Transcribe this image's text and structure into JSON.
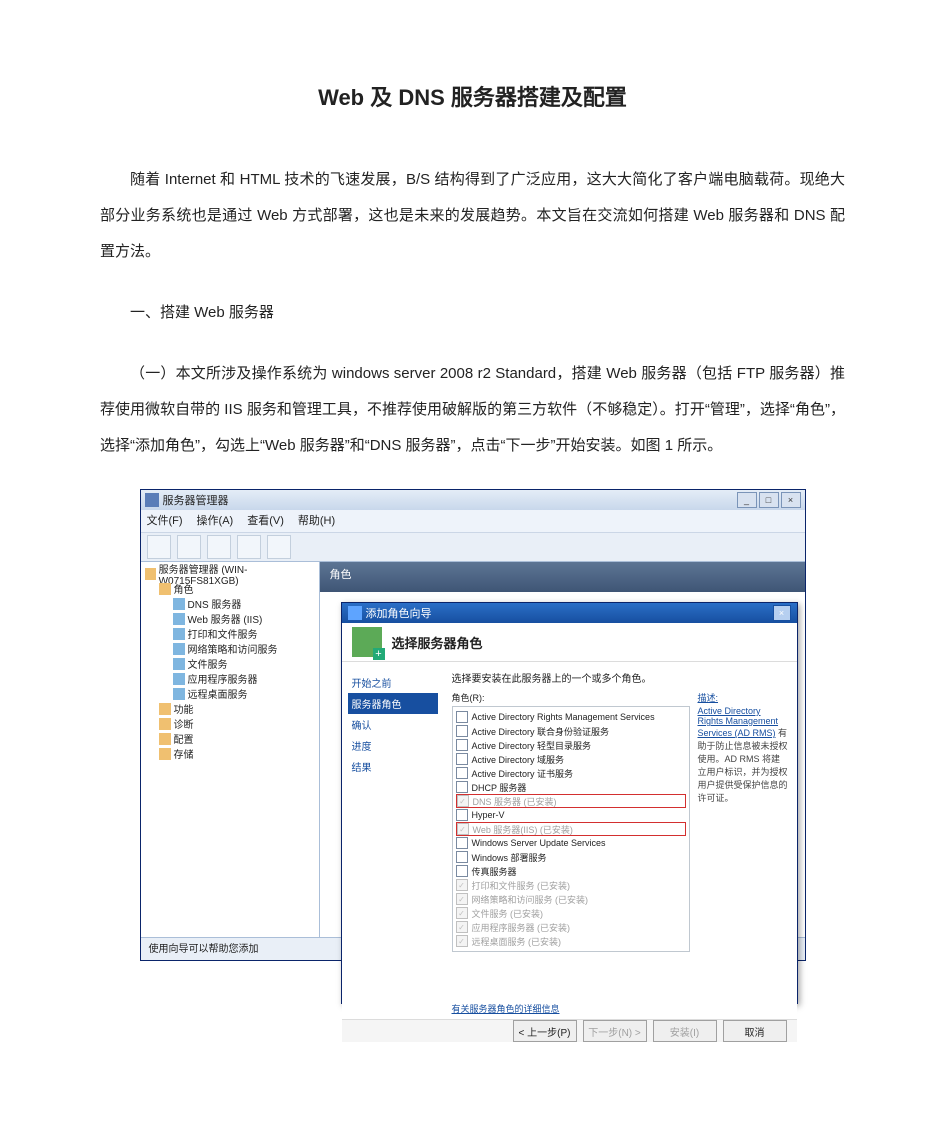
{
  "doc": {
    "title": "Web 及 DNS 服务器搭建及配置",
    "para1": "随着 Internet 和 HTML 技术的飞速发展，B/S 结构得到了广泛应用，这大大简化了客户端电脑载荷。现绝大部分业务系统也是通过 Web 方式部署，这也是未来的发展趋势。本文旨在交流如何搭建 Web 服务器和 DNS 配置方法。",
    "section1": "一、搭建 Web 服务器",
    "para2": "（一）本文所涉及操作系统为 windows server 2008 r2 Standard，搭建 Web 服务器（包括 FTP 服务器）推荐使用微软自带的 IIS 服务和管理工具，不推荐使用破解版的第三方软件（不够稳定）。打开“管理”，选择“角色”，选择“添加角色”，勾选上“Web 服务器”和“DNS 服务器”，点击“下一步”开始安装。如图 1 所示。"
  },
  "server_manager": {
    "window_title": "服务器管理器",
    "menubar": [
      "文件(F)",
      "操作(A)",
      "查看(V)",
      "帮助(H)"
    ],
    "titlectrls": [
      "_",
      "□",
      "×"
    ],
    "tree": {
      "root": "服务器管理器 (WIN-W0715FS81XGB)",
      "roles": "角色",
      "role_items": [
        "DNS 服务器",
        "Web 服务器 (IIS)",
        "打印和文件服务",
        "网络策略和访问服务",
        "文件服务",
        "应用程序服务器",
        "远程桌面服务"
      ],
      "features": "功能",
      "diagnostics": "诊断",
      "config": "配置",
      "storage": "存储"
    },
    "main_header": "角色",
    "status": "使用向导可以帮助您添加"
  },
  "wizard": {
    "title": "添加角色向导",
    "titlectrls": [
      "×"
    ],
    "header_title": "选择服务器角色",
    "nav": {
      "start": "开始之前",
      "roles": "服务器角色",
      "confirm": "确认",
      "progress": "进度",
      "result": "结果"
    },
    "instruction": "选择要安装在此服务器上的一个或多个角色。",
    "group_label": "角色(R):",
    "desc_label": "描述:",
    "roles_list": [
      {
        "label": "Active Directory Rights Management Services",
        "checked": false,
        "disabled": false,
        "dim": false
      },
      {
        "label": "Active Directory 联合身份验证服务",
        "checked": false,
        "disabled": false,
        "dim": false
      },
      {
        "label": "Active Directory 轻型目录服务",
        "checked": false,
        "disabled": false,
        "dim": false
      },
      {
        "label": "Active Directory 域服务",
        "checked": false,
        "disabled": false,
        "dim": false
      },
      {
        "label": "Active Directory 证书服务",
        "checked": false,
        "disabled": false,
        "dim": false
      },
      {
        "label": "DHCP 服务器",
        "checked": false,
        "disabled": false,
        "dim": false
      },
      {
        "label": "DNS 服务器  (已安装)",
        "checked": true,
        "disabled": true,
        "dim": true,
        "highlight": true
      },
      {
        "label": "Hyper-V",
        "checked": false,
        "disabled": false,
        "dim": false
      },
      {
        "label": "Web 服务器(IIS)  (已安装)",
        "checked": true,
        "disabled": true,
        "dim": true,
        "highlight": true
      },
      {
        "label": "Windows Server Update Services",
        "checked": false,
        "disabled": false,
        "dim": false
      },
      {
        "label": "Windows 部署服务",
        "checked": false,
        "disabled": false,
        "dim": false
      },
      {
        "label": "传真服务器",
        "checked": false,
        "disabled": false,
        "dim": false
      },
      {
        "label": "打印和文件服务  (已安装)",
        "checked": true,
        "disabled": true,
        "dim": true
      },
      {
        "label": "网络策略和访问服务  (已安装)",
        "checked": true,
        "disabled": true,
        "dim": true
      },
      {
        "label": "文件服务  (已安装)",
        "checked": true,
        "disabled": true,
        "dim": true
      },
      {
        "label": "应用程序服务器  (已安装)",
        "checked": true,
        "disabled": true,
        "dim": true
      },
      {
        "label": "远程桌面服务  (已安装)",
        "checked": true,
        "disabled": true,
        "dim": true
      }
    ],
    "desc_link": "Active Directory Rights Management Services (AD RMS)",
    "desc_text": "有助于防止信息被未授权使用。AD RMS 将建立用户标识，并为授权用户提供受保护信息的许可证。",
    "more_link": "有关服务器角色的详细信息",
    "buttons": {
      "back": "< 上一步(P)",
      "next": "下一步(N) >",
      "install": "安装(I)",
      "cancel": "取消"
    }
  }
}
